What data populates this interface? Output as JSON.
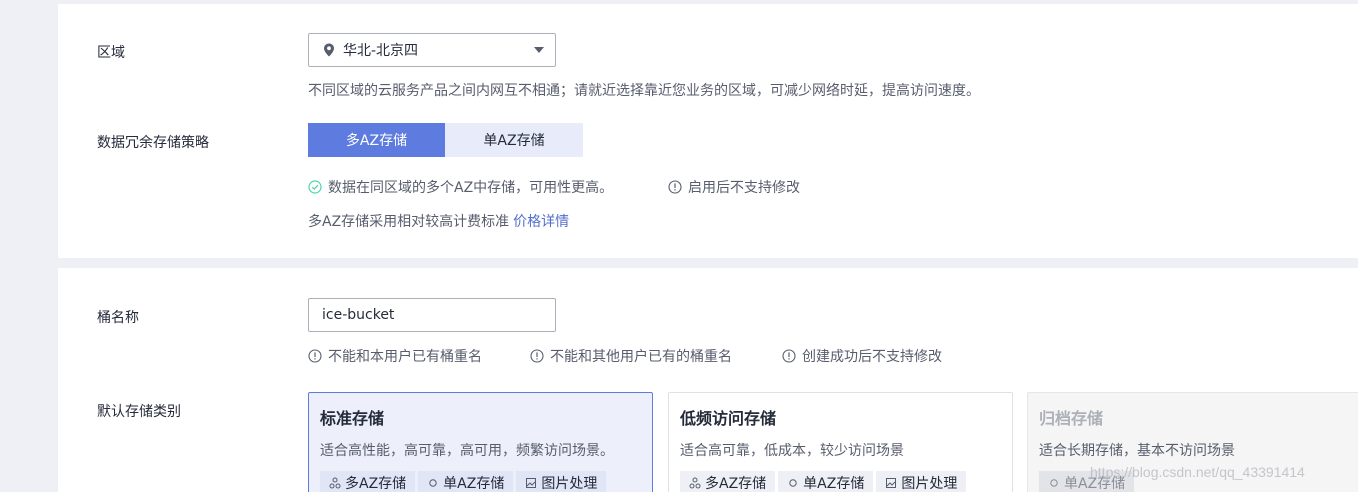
{
  "region": {
    "label": "区域",
    "value": "华北-北京四",
    "hint": "不同区域的云服务产品之间内网互不相通；请就近选择靠近您业务的区域，可减少网络时延，提高访问速度。"
  },
  "redundancy": {
    "label": "数据冗余存储策略",
    "options": [
      "多AZ存储",
      "单AZ存储"
    ],
    "selected": "多AZ存储",
    "hint_available": "数据在同区域的多个AZ中存储，可用性更高。",
    "hint_immutable": "启用后不支持修改",
    "pricing_text": "多AZ存储采用相对较高计费标准",
    "pricing_link": "价格详情"
  },
  "bucket": {
    "label": "桶名称",
    "value": "ice-bucket",
    "rules": [
      "不能和本用户已有桶重名",
      "不能和其他用户已有的桶重名",
      "创建成功后不支持修改"
    ]
  },
  "storage_class": {
    "label": "默认存储类别",
    "options": [
      {
        "title": "标准存储",
        "desc": "适合高性能，高可靠，高可用，频繁访问场景。",
        "tags": [
          "多AZ存储",
          "单AZ存储",
          "图片处理"
        ],
        "state": "selected"
      },
      {
        "title": "低频访问存储",
        "desc": "适合高可靠，低成本，较少访问场景",
        "tags": [
          "多AZ存储",
          "单AZ存储",
          "图片处理"
        ],
        "state": "normal"
      },
      {
        "title": "归档存储",
        "desc": "适合长期存储，基本不访问场景",
        "tags": [
          "单AZ存储"
        ],
        "state": "disabled"
      }
    ]
  },
  "watermark": "https://blog.csdn.net/qq_43391414",
  "colors": {
    "accent": "#5e7ce0",
    "success": "#50d4ab",
    "link": "#526ecc"
  }
}
